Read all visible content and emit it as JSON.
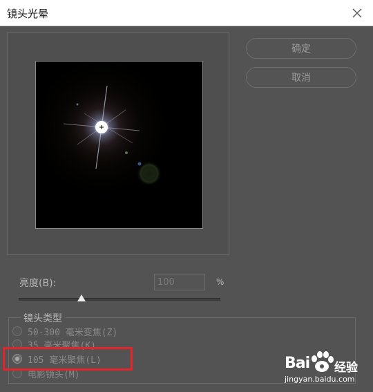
{
  "window": {
    "title": "镜头光晕",
    "close_icon": "close-icon"
  },
  "buttons": {
    "ok_label": "确定",
    "cancel_label": "取消"
  },
  "brightness": {
    "label": "亮度(B):",
    "value": "100",
    "unit": "%",
    "slider_fraction": 0.31
  },
  "lens_type": {
    "legend": "镜头类型",
    "options": [
      {
        "label": "50-300 毫米变焦(Z)",
        "checked": false
      },
      {
        "label": "35 毫米聚焦(K)",
        "checked": false
      },
      {
        "label": "105 毫米聚焦(L)",
        "checked": true
      },
      {
        "label": "电影镜头(M)",
        "checked": false
      }
    ]
  },
  "annotation": {
    "highlight_color": "#e1252a"
  },
  "watermark": {
    "logo_left": "Bai",
    "logo_right": "du",
    "cn_text": "经验",
    "url": "jingyan.baidu.com"
  }
}
